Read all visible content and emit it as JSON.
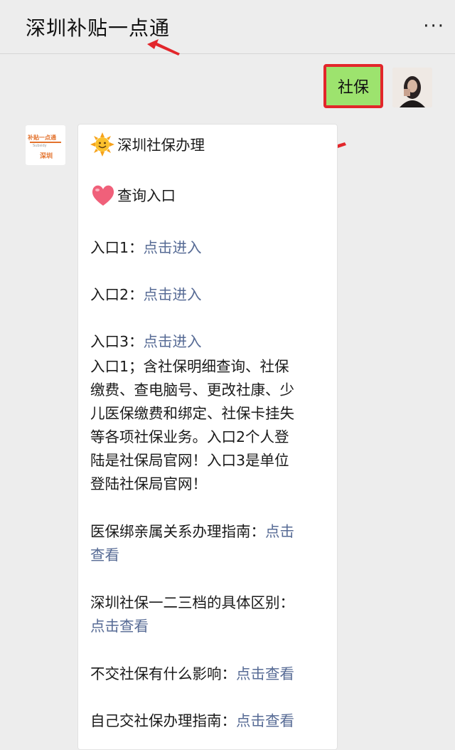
{
  "header": {
    "title": "深圳补贴一点通",
    "more_icon": "more-dots-icon"
  },
  "user_message": {
    "text": "社保",
    "highlight_color": "#e2262b",
    "bubble_color": "#9de36e"
  },
  "bot_message": {
    "heading": "深圳社保办理",
    "subheading": "查询入口",
    "entries": [
      {
        "label": "入口1：",
        "link": "点击进入"
      },
      {
        "label": "入口2：",
        "link": "点击进入"
      },
      {
        "label": "入口3：",
        "link": "点击进入"
      }
    ],
    "description_lines": [
      "入口1；含社保明细查询、社保",
      "缴费、查电脑号、更改社康、少",
      "儿医保缴费和绑定、社保卡挂失",
      "等各项社保业务。入口2个人登",
      "陆是社保局官网！入口3是单位",
      "登陆社保局官网！"
    ],
    "guides": [
      {
        "text": "医保绑亲属关系办理指南：",
        "link": "点击",
        "link2": "查看"
      },
      {
        "text": "深圳社保一二三档的具体区别：",
        "link": "点击查看"
      },
      {
        "text": "不交社保有什么影响：",
        "link": "点击查看"
      },
      {
        "text": "自己交社保办理指南：",
        "link": "点击查看"
      }
    ],
    "link_color": "#576b95"
  }
}
